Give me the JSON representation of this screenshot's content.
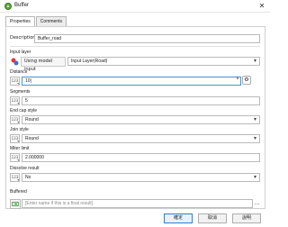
{
  "window": {
    "title": "Buffer"
  },
  "tabs": [
    {
      "label": "Properties"
    },
    {
      "label": "Comments"
    }
  ],
  "description": {
    "label": "Description",
    "value": "Buffer_road"
  },
  "input_layer": {
    "label": "Input layer",
    "source_button": "Using model input",
    "value": "Input Layer(Road)"
  },
  "distance": {
    "label": "Distance",
    "icon_text": "123",
    "value": "10|"
  },
  "segments": {
    "label": "Segments",
    "icon_text": "123",
    "value": "5"
  },
  "end_cap": {
    "label": "End cap style",
    "icon_text": "123",
    "value": "Round"
  },
  "join_style": {
    "label": "Join style",
    "icon_text": "123",
    "value": "Round"
  },
  "miter_limit": {
    "label": "Miter limit",
    "icon_text": "123",
    "value": "2.000000"
  },
  "dissolve": {
    "label": "Dissolve result",
    "icon_text": "123",
    "value": "No"
  },
  "buffered": {
    "label": "Buffered",
    "placeholder": "[Enter name if this is a final result]",
    "dots": "…"
  },
  "buttons": {
    "ok": "確定",
    "cancel": "取消",
    "help": "說明"
  },
  "icons": {
    "close": "✕",
    "spin": "⬍",
    "tool": "⚙"
  }
}
